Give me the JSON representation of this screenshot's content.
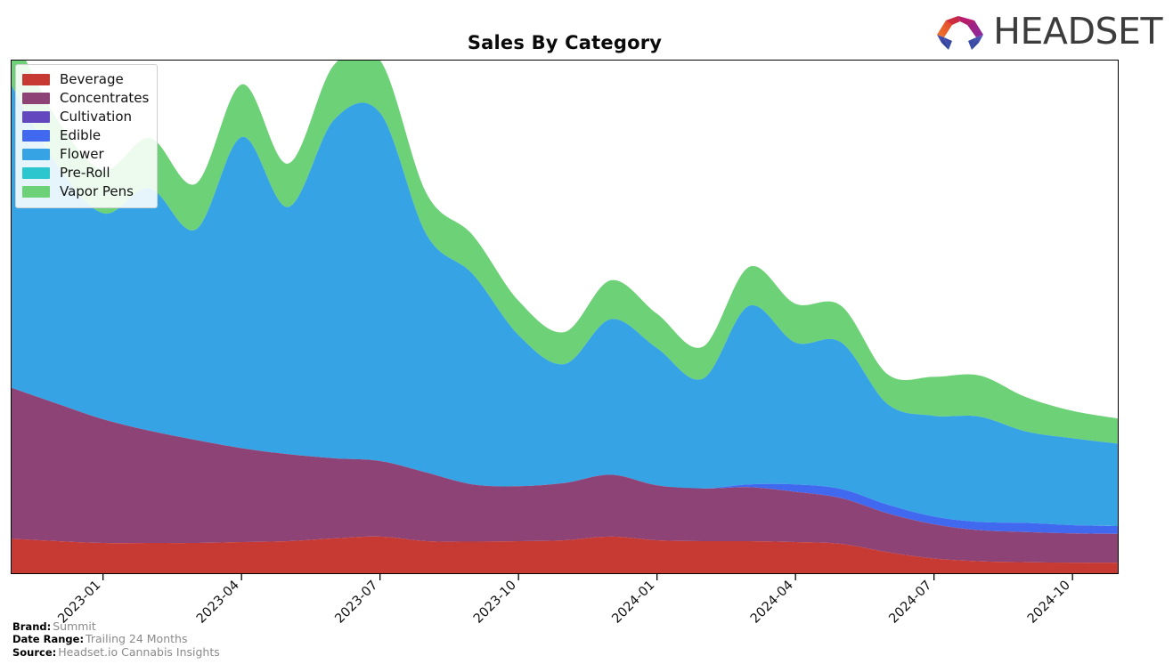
{
  "header": {
    "title": "Sales By Category",
    "logo_text": "HEADSET",
    "logo_icon": "headset-hexagon-logo"
  },
  "footer": {
    "rows": [
      {
        "key": "Brand:",
        "value": "Summit"
      },
      {
        "key": "Date Range:",
        "value": "Trailing 24 Months"
      },
      {
        "key": "Source:",
        "value": "Headset.io Cannabis Insights"
      }
    ]
  },
  "legend": {
    "position": "top-left",
    "entries": [
      {
        "label": "Beverage",
        "color": "#C63A33"
      },
      {
        "label": "Concentrates",
        "color": "#8E4377"
      },
      {
        "label": "Cultivation",
        "color": "#6347BE"
      },
      {
        "label": "Edible",
        "color": "#4169F0"
      },
      {
        "label": "Flower",
        "color": "#35A3E4"
      },
      {
        "label": "Pre-Roll",
        "color": "#2CC6CE"
      },
      {
        "label": "Vapor Pens",
        "color": "#6DD177"
      }
    ]
  },
  "chart_data": {
    "type": "area",
    "stacked": true,
    "title": "Sales By Category",
    "xlabel": "",
    "ylabel": "",
    "grid": false,
    "interpolation": "smooth-spline",
    "axis_y_visible": false,
    "x": [
      "2022-11",
      "2022-12",
      "2023-01",
      "2023-02",
      "2023-03",
      "2023-04",
      "2023-05",
      "2023-06",
      "2023-07",
      "2023-08",
      "2023-09",
      "2023-10",
      "2023-11",
      "2023-12",
      "2024-01",
      "2024-02",
      "2024-03",
      "2024-04",
      "2024-05",
      "2024-06",
      "2024-07",
      "2024-08",
      "2024-09",
      "2024-10",
      "2024-11"
    ],
    "x_ticks": [
      "2023-01",
      "2023-04",
      "2023-07",
      "2023-10",
      "2024-01",
      "2024-04",
      "2024-07",
      "2024-10"
    ],
    "ylim": [
      0,
      112
    ],
    "series": [
      {
        "name": "Beverage",
        "color": "#C63A33",
        "values": [
          7.5,
          7.0,
          6.6,
          6.6,
          6.6,
          6.8,
          7.0,
          7.6,
          8.0,
          7.0,
          6.9,
          7.0,
          7.2,
          8.0,
          7.2,
          7.0,
          7.0,
          6.8,
          6.4,
          4.6,
          3.2,
          2.6,
          2.4,
          2.3,
          2.3
        ]
      },
      {
        "name": "Concentrates",
        "color": "#8E4377",
        "values": [
          33.0,
          30.0,
          27.0,
          24.5,
          22.5,
          20.5,
          19.0,
          17.5,
          16.5,
          15.0,
          12.5,
          12.0,
          12.5,
          13.5,
          12.0,
          11.5,
          11.8,
          11.0,
          10.0,
          8.5,
          7.5,
          6.8,
          6.6,
          6.4,
          6.3
        ]
      },
      {
        "name": "Cultivation",
        "color": "#6347BE",
        "values": [
          0,
          0,
          0,
          0,
          0,
          0,
          0,
          0,
          0,
          0,
          0,
          0,
          0,
          0,
          0,
          0,
          0,
          0,
          0,
          0,
          0,
          0,
          0,
          0,
          0
        ]
      },
      {
        "name": "Edible",
        "color": "#4169F0",
        "values": [
          0,
          0,
          0,
          0,
          0,
          0,
          0,
          0,
          0,
          0,
          0,
          0,
          0,
          0,
          0,
          0,
          0.6,
          1.6,
          2.0,
          1.9,
          1.7,
          1.8,
          2.0,
          1.8,
          1.7
        ]
      },
      {
        "name": "Flower",
        "color": "#35A3E4",
        "values": [
          66.0,
          52.0,
          45.0,
          53.0,
          46.0,
          68.0,
          54.0,
          74.0,
          76.0,
          52.0,
          46.0,
          33.0,
          26.0,
          34.0,
          30.0,
          24.0,
          39.0,
          31.0,
          32.0,
          22.0,
          22.0,
          23.0,
          20.0,
          19.0,
          18.0
        ]
      },
      {
        "name": "Pre-Roll",
        "color": "#2CC6CE",
        "values": [
          0,
          0,
          0,
          0,
          0,
          0,
          0,
          0,
          0,
          0,
          0,
          0,
          0,
          0,
          0,
          0,
          0,
          0,
          0,
          0,
          0,
          0,
          0,
          0,
          0
        ]
      },
      {
        "name": "Vapor Pens",
        "color": "#6DD177",
        "values": [
          12.0,
          10.0,
          9.5,
          11.0,
          10.0,
          11.5,
          9.5,
          12.0,
          11.5,
          9.0,
          8.5,
          7.5,
          7.0,
          8.5,
          7.5,
          7.0,
          8.5,
          8.5,
          8.0,
          6.5,
          8.5,
          9.0,
          7.5,
          6.0,
          5.5
        ]
      }
    ]
  }
}
